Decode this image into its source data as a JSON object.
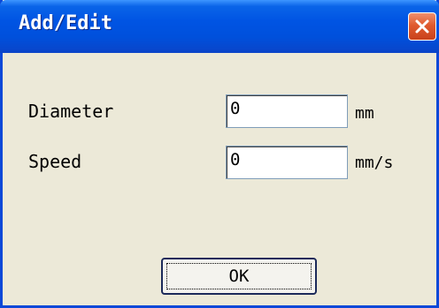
{
  "window": {
    "title": "Add/Edit",
    "close_icon": "close-icon"
  },
  "form": {
    "diameter": {
      "label": "Diameter",
      "value": "0",
      "unit": "mm"
    },
    "speed": {
      "label": "Speed",
      "value": "0",
      "unit": "mm/s"
    }
  },
  "buttons": {
    "ok_label": "OK"
  },
  "colors": {
    "titlebar": "#0054e3",
    "close": "#e05a2e",
    "background": "#ece9d8"
  }
}
